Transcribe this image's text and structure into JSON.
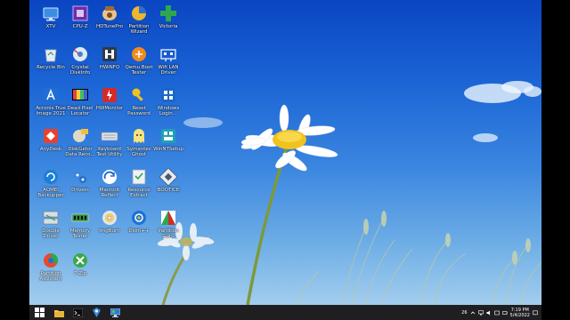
{
  "desktop": {
    "icons": [
      {
        "label": "XTV",
        "icon": "tv-icon"
      },
      {
        "label": "CPU-Z",
        "icon": "cpu-icon"
      },
      {
        "label": "HDTunePro",
        "icon": "hd-tune-icon"
      },
      {
        "label": "Partition Wizard",
        "icon": "partition-wizard-icon"
      },
      {
        "label": "Victoria",
        "icon": "victoria-cross-icon"
      },
      {
        "label": "Recycle Bin",
        "icon": "recycle-bin-icon"
      },
      {
        "label": "Crystal DiskInfo",
        "icon": "crystal-diskinfo-icon"
      },
      {
        "label": "HWiNFO",
        "icon": "hwinfo-icon"
      },
      {
        "label": "Qemu Boot Tester",
        "icon": "qemu-icon"
      },
      {
        "label": "Wifi LAN Driver",
        "icon": "network-driver-icon"
      },
      {
        "label": "Acronis True Image 2021",
        "icon": "acronis-icon"
      },
      {
        "label": "Dead Pixel Locator",
        "icon": "dead-pixel-icon"
      },
      {
        "label": "HWMonitor",
        "icon": "hwmonitor-icon"
      },
      {
        "label": "Reset Password",
        "icon": "key-icon"
      },
      {
        "label": "Windows Login...",
        "icon": "windows-login-icon"
      },
      {
        "label": "AnyDesk",
        "icon": "anydesk-icon"
      },
      {
        "label": "DiskGetor Data Reco...",
        "icon": "diskgetor-icon"
      },
      {
        "label": "Keyboard Test Utility",
        "icon": "keyboard-icon"
      },
      {
        "label": "Symantec Ghost",
        "icon": "ghost-icon"
      },
      {
        "label": "WinNTSetup",
        "icon": "winntsetup-icon"
      },
      {
        "label": "AOMEI Backupper",
        "icon": "aomei-icon"
      },
      {
        "label": "Drivers",
        "icon": "drivers-icon"
      },
      {
        "label": "Macrorit Reflect",
        "icon": "macrorit-icon"
      },
      {
        "label": "Resource Extract",
        "icon": "resource-icon"
      },
      {
        "label": "BOOTICE",
        "icon": "bootice-icon"
      },
      {
        "label": "Double Driver",
        "icon": "double-driver-icon"
      },
      {
        "label": "Memory Tester",
        "icon": "memory-icon"
      },
      {
        "label": "ImgBurn",
        "icon": "disc-icon"
      },
      {
        "label": "Dism++",
        "icon": "dism-icon"
      },
      {
        "label": "Partition Guru",
        "icon": "partition-guru-icon"
      },
      {
        "label": "Partition Assistant",
        "icon": "partition-assistant-icon"
      },
      {
        "label": "7-Zip",
        "icon": "zip-icon"
      }
    ]
  },
  "taskbar": {
    "items": [
      {
        "name": "start-button",
        "icon": "windows-logo-icon"
      },
      {
        "name": "file-explorer-button",
        "icon": "folder-icon"
      },
      {
        "name": "command-prompt-button",
        "icon": "terminal-icon"
      },
      {
        "name": "pinned-app-button",
        "icon": "app-icon"
      },
      {
        "name": "task-manager-button",
        "icon": "monitor-icon"
      }
    ],
    "tray": {
      "temperature": "26",
      "time": "7:19 PM",
      "date": "5/4/2022"
    }
  },
  "colors": {
    "sky_top": "#0a45c2",
    "sky_bottom": "#a3cdee",
    "taskbar": "#1f1f22",
    "daisy_center": "#f2c21c"
  }
}
